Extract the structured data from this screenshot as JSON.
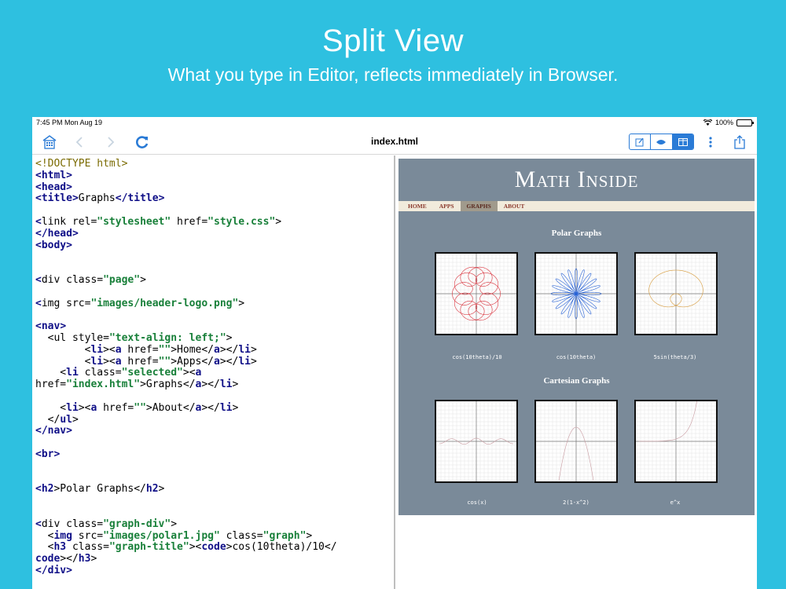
{
  "hero": {
    "title": "Split View",
    "subtitle": "What you type in Editor, reflects immediately in Browser."
  },
  "status": {
    "time": "7:45 PM  Mon Aug 19",
    "battery": "100%"
  },
  "toolbar": {
    "filename": "index.html"
  },
  "code_lines": [
    [
      [
        "doc",
        "<!DOCTYPE html>"
      ]
    ],
    [
      [
        "t",
        "<"
      ],
      [
        "t",
        "html"
      ],
      [
        "t",
        ">"
      ]
    ],
    [
      [
        "t",
        "<"
      ],
      [
        "t",
        "head"
      ],
      [
        "t",
        ">"
      ]
    ],
    [
      [
        "t",
        "<"
      ],
      [
        "t",
        "title"
      ],
      [
        "t",
        ">"
      ],
      [
        "p",
        "Graphs"
      ],
      [
        "t",
        "</"
      ],
      [
        "t",
        "title"
      ],
      [
        "t",
        ">"
      ]
    ],
    [],
    [
      [
        "t",
        "<"
      ],
      [
        "p",
        "link rel="
      ],
      [
        "s",
        "\"stylesheet\""
      ],
      [
        "p",
        " href="
      ],
      [
        "s",
        "\"style.css\""
      ],
      [
        "p",
        ">"
      ]
    ],
    [
      [
        "t",
        "</"
      ],
      [
        "t",
        "head"
      ],
      [
        "t",
        ">"
      ]
    ],
    [
      [
        "t",
        "<"
      ],
      [
        "t",
        "body"
      ],
      [
        "t",
        ">"
      ]
    ],
    [],
    [],
    [
      [
        "t",
        "<"
      ],
      [
        "p",
        "div class="
      ],
      [
        "s",
        "\"page\""
      ],
      [
        "p",
        ">"
      ]
    ],
    [],
    [
      [
        "t",
        "<"
      ],
      [
        "p",
        "img src="
      ],
      [
        "s",
        "\"images/header-logo.png\""
      ],
      [
        "p",
        ">"
      ]
    ],
    [],
    [
      [
        "t",
        "<"
      ],
      [
        "t",
        "nav"
      ],
      [
        "t",
        ">"
      ]
    ],
    [
      [
        "p",
        "  <"
      ],
      [
        "p",
        "ul style="
      ],
      [
        "s",
        "\"text-align: left;\""
      ],
      [
        "p",
        ">"
      ]
    ],
    [
      [
        "p",
        "        <"
      ],
      [
        "t",
        "li"
      ],
      [
        "p",
        "><"
      ],
      [
        "t",
        "a"
      ],
      [
        "p",
        " href="
      ],
      [
        "s",
        "\"\""
      ],
      [
        "p",
        ">Home</"
      ],
      [
        "t",
        "a"
      ],
      [
        "p",
        "></"
      ],
      [
        "t",
        "li"
      ],
      [
        "p",
        ">"
      ]
    ],
    [
      [
        "p",
        "        <"
      ],
      [
        "t",
        "li"
      ],
      [
        "p",
        "><"
      ],
      [
        "t",
        "a"
      ],
      [
        "p",
        " href="
      ],
      [
        "s",
        "\"\""
      ],
      [
        "p",
        ">Apps</"
      ],
      [
        "t",
        "a"
      ],
      [
        "p",
        "></"
      ],
      [
        "t",
        "li"
      ],
      [
        "p",
        ">"
      ]
    ],
    [
      [
        "p",
        "    <"
      ],
      [
        "t",
        "li"
      ],
      [
        "p",
        " class="
      ],
      [
        "s",
        "\"selected\""
      ],
      [
        "p",
        "><"
      ],
      [
        "t",
        "a"
      ]
    ],
    [
      [
        "p",
        "href="
      ],
      [
        "s",
        "\"index.html\""
      ],
      [
        "p",
        ">Graphs</"
      ],
      [
        "t",
        "a"
      ],
      [
        "p",
        "></"
      ],
      [
        "t",
        "li"
      ],
      [
        "p",
        ">"
      ]
    ],
    [],
    [
      [
        "p",
        "    <"
      ],
      [
        "t",
        "li"
      ],
      [
        "p",
        "><"
      ],
      [
        "t",
        "a"
      ],
      [
        "p",
        " href="
      ],
      [
        "s",
        "\"\""
      ],
      [
        "p",
        ">About</"
      ],
      [
        "t",
        "a"
      ],
      [
        "p",
        "></"
      ],
      [
        "t",
        "li"
      ],
      [
        "p",
        ">"
      ]
    ],
    [
      [
        "p",
        "  </"
      ],
      [
        "t",
        "ul"
      ],
      [
        "p",
        ">"
      ]
    ],
    [
      [
        "t",
        "</"
      ],
      [
        "t",
        "nav"
      ],
      [
        "t",
        ">"
      ]
    ],
    [],
    [
      [
        "t",
        "<"
      ],
      [
        "t",
        "br"
      ],
      [
        "t",
        ">"
      ]
    ],
    [],
    [],
    [
      [
        "t",
        "<"
      ],
      [
        "t",
        "h2"
      ],
      [
        "p",
        ">Polar Graphs</"
      ],
      [
        "t",
        "h2"
      ],
      [
        "p",
        ">"
      ]
    ],
    [],
    [],
    [
      [
        "t",
        "<"
      ],
      [
        "p",
        "div class="
      ],
      [
        "s",
        "\"graph-div\""
      ],
      [
        "p",
        ">"
      ]
    ],
    [
      [
        "p",
        "  <"
      ],
      [
        "t",
        "img"
      ],
      [
        "p",
        " src="
      ],
      [
        "s",
        "\"images/polar1.jpg\""
      ],
      [
        "p",
        " class="
      ],
      [
        "s",
        "\"graph\""
      ],
      [
        "p",
        ">"
      ]
    ],
    [
      [
        "p",
        "  <"
      ],
      [
        "t",
        "h3"
      ],
      [
        "p",
        " class="
      ],
      [
        "s",
        "\"graph-title\""
      ],
      [
        "p",
        "><"
      ],
      [
        "t",
        "code"
      ],
      [
        "p",
        ">cos(10theta)/10</"
      ]
    ],
    [
      [
        "t",
        "code"
      ],
      [
        "p",
        "></"
      ],
      [
        "t",
        "h3"
      ],
      [
        "p",
        ">"
      ]
    ],
    [
      [
        "t",
        "</"
      ],
      [
        "t",
        "div"
      ],
      [
        "t",
        ">"
      ]
    ]
  ],
  "site": {
    "logo": "Math Inside",
    "nav": [
      "HOME",
      "APPS",
      "GRAPHS",
      "ABOUT"
    ],
    "selected_nav": 2,
    "polar_title": "Polar Graphs",
    "cartesian_title": "Cartesian Graphs",
    "polar_graphs": [
      {
        "caption": "cos(10theta)/10",
        "color": "#d9303a",
        "kind": "polar1"
      },
      {
        "caption": "cos(10theta)",
        "color": "#2a64d6",
        "kind": "polar2"
      },
      {
        "caption": "5sin(theta/3)",
        "color": "#d69a3a",
        "kind": "polar3"
      }
    ],
    "cartesian_graphs": [
      {
        "caption": "cos(x)",
        "color": "#c89aa0",
        "kind": "cos"
      },
      {
        "caption": "2(1-x^2)",
        "color": "#c89aa0",
        "kind": "parab"
      },
      {
        "caption": "e^x",
        "color": "#c89aa0",
        "kind": "exp"
      }
    ]
  }
}
